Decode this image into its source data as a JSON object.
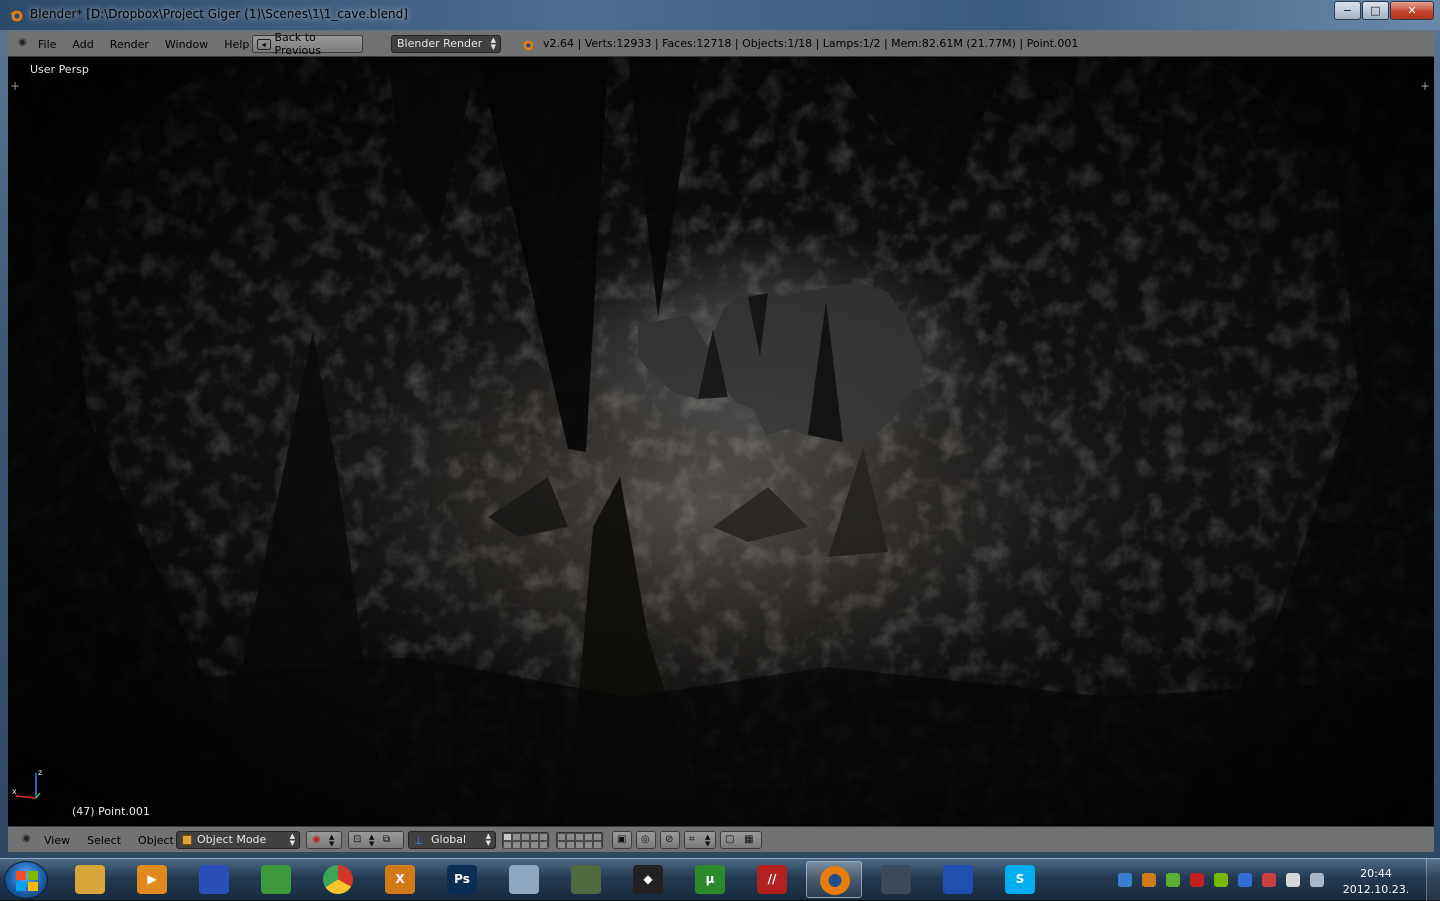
{
  "window": {
    "title": "Blender* [D:\\Dropbox\\Project Giger (1)\\Scenes\\1\\1_cave.blend]",
    "controls": {
      "minimize": "−",
      "maximize": "□",
      "close": "✕"
    }
  },
  "header": {
    "menus": [
      "File",
      "Add",
      "Render",
      "Window",
      "Help"
    ],
    "back_button": "Back to Previous",
    "render_engine": "Blender Render",
    "stats": "v2.64 | Verts:12933 | Faces:12718 | Objects:1/18 | Lamps:1/2 | Mem:82.61M (21.77M) | Point.001"
  },
  "viewport": {
    "view_label": "User Persp",
    "object_label": "(47) Point.001",
    "axis_labels": {
      "x": "x",
      "z": "z"
    }
  },
  "footer": {
    "menus": [
      "View",
      "Select",
      "Object"
    ],
    "mode": "Object Mode",
    "orientation": "Global"
  },
  "taskbar": {
    "apps": [
      {
        "name": "explorer",
        "color": "#d6a63a",
        "glyph": ""
      },
      {
        "name": "media-player",
        "color": "#e08a1e",
        "glyph": "▶"
      },
      {
        "name": "save-disk",
        "color": "#2a4fb8",
        "glyph": ""
      },
      {
        "name": "network",
        "color": "#3c9a3c",
        "glyph": ""
      },
      {
        "name": "chrome",
        "color": "#d4352b",
        "glyph": ""
      },
      {
        "name": "cpot",
        "color": "#d07a18",
        "glyph": "X"
      },
      {
        "name": "photoshop",
        "color": "#0c2d52",
        "glyph": "Ps"
      },
      {
        "name": "calculator",
        "color": "#8fa8c2",
        "glyph": ""
      },
      {
        "name": "monitor",
        "color": "#4f6b40",
        "glyph": ""
      },
      {
        "name": "unity-1",
        "color": "#222222",
        "glyph": "◆"
      },
      {
        "name": "utorrent",
        "color": "#2c8a2c",
        "glyph": "µ"
      },
      {
        "name": "stripes",
        "color": "#b22020",
        "glyph": "//"
      },
      {
        "name": "blender",
        "color": "#e87d0d",
        "glyph": ""
      },
      {
        "name": "unity-2",
        "color": "#3a4a5a",
        "glyph": ""
      },
      {
        "name": "car",
        "color": "#1f4fb0",
        "glyph": ""
      },
      {
        "name": "skype",
        "color": "#00aff0",
        "glyph": "S"
      }
    ],
    "clock_time": "20:44",
    "clock_date": "2012.10.23."
  },
  "colors": {
    "blender_header": "#727272",
    "dropdown": "#404040",
    "accent_orange": "#e87d0d"
  }
}
